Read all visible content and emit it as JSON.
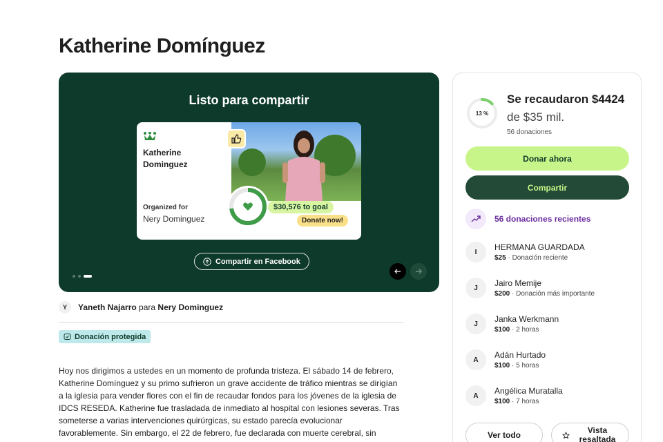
{
  "page": {
    "title": "Katherine Domínguez"
  },
  "hero": {
    "title": "Listo para compartir",
    "card": {
      "name": "Katherine Dominguez",
      "organized_label": "Organized for",
      "organized_name": "Nery Dominguez",
      "goal_text": "$30,576 to goal",
      "donate_text": "Donate now!"
    },
    "share_fb_label": "Compartir en Facebook",
    "slide_count": 3,
    "active_slide": 3
  },
  "author": {
    "initial": "Y",
    "name": "Yaneth Najarro",
    "connector": "para",
    "beneficiary": "Nery Dominguez"
  },
  "badge": {
    "label": "Donación protegida"
  },
  "story": {
    "text": "Hoy nos dirigimos a ustedes en un momento de profunda tristeza. El sábado 14 de febrero, Katherine Domínguez y su primo sufrieron un grave accidente de tráfico mientras se dirigían a la iglesia para vender flores con el fin de recaudar fondos para los jóvenes de la iglesia de IDCS RESEDA. Katherine fue trasladada de inmediato al hospital con lesiones severas. Tras someterse a varias intervenciones quirúrgicas, su estado parecía evolucionar favorablemente. Sin embargo, el 22 de febrero, fue declarada con muerte cerebral, sin"
  },
  "sidebar": {
    "progress_label": "13 %",
    "progress_fraction": 0.13,
    "raised": "Se recaudaron $4424",
    "goal": "de $35 mil.",
    "count": "56 donaciones",
    "donate_button": "Donar ahora",
    "share_button": "Compartir",
    "recent_label": "56 donaciones recientes",
    "donors": [
      {
        "initial": "I",
        "name": "HERMANA GUARDADA",
        "amount": "$25",
        "note": " · Donación reciente"
      },
      {
        "initial": "J",
        "name": "Jairo Memije",
        "amount": "$200",
        "note": " · Donación más importante"
      },
      {
        "initial": "J",
        "name": "Janka Werkmann",
        "amount": "$100",
        "note": " · 2 horas"
      },
      {
        "initial": "A",
        "name": "Adán Hurtado",
        "amount": "$100",
        "note": " · 5 horas"
      },
      {
        "initial": "A",
        "name": "Angélica Muratalla",
        "amount": "$100",
        "note": " · 7 horas"
      }
    ],
    "see_all_button": "Ver todo",
    "featured_button": "Vista resaltada"
  },
  "colors": {
    "hero_bg": "#0d3a2a",
    "accent_green": "#c8f58a",
    "dark_green": "#224a36",
    "purple": "#6b2fa0"
  }
}
